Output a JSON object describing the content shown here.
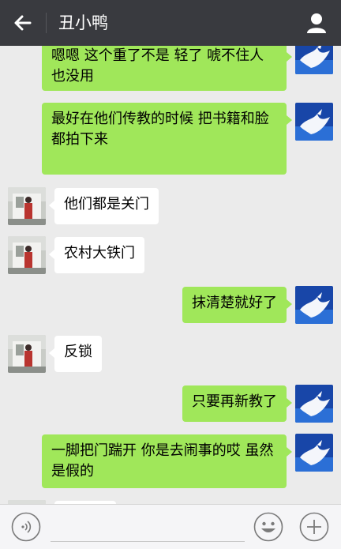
{
  "header": {
    "title": "丑小鸭"
  },
  "messages": [
    {
      "side": "out",
      "text": "嗯嗯  这个重了不是 轻了 唬不住人也没用"
    },
    {
      "side": "out",
      "text": "最好在他们传教的时候  把书籍和脸都拍下来"
    },
    {
      "side": "in",
      "text": "他们都是关门"
    },
    {
      "side": "in",
      "text": "农村大铁门"
    },
    {
      "side": "out",
      "text": "抹清楚就好了"
    },
    {
      "side": "in",
      "text": "反锁"
    },
    {
      "side": "out",
      "text": "只要再新教了"
    },
    {
      "side": "out",
      "text": "一脚把门踹开 你是去闹事的哎  虽然是假的"
    }
  ],
  "icons": {
    "back": "arrow-left-icon",
    "contact": "person-icon",
    "voice": "voice-icon",
    "emoji": "emoji-icon",
    "more": "plus-icon"
  },
  "colors": {
    "header_bg": "#393a3f",
    "outgoing_bubble": "#a0e75a",
    "incoming_bubble": "#ffffff",
    "chat_bg": "#ebebeb"
  }
}
